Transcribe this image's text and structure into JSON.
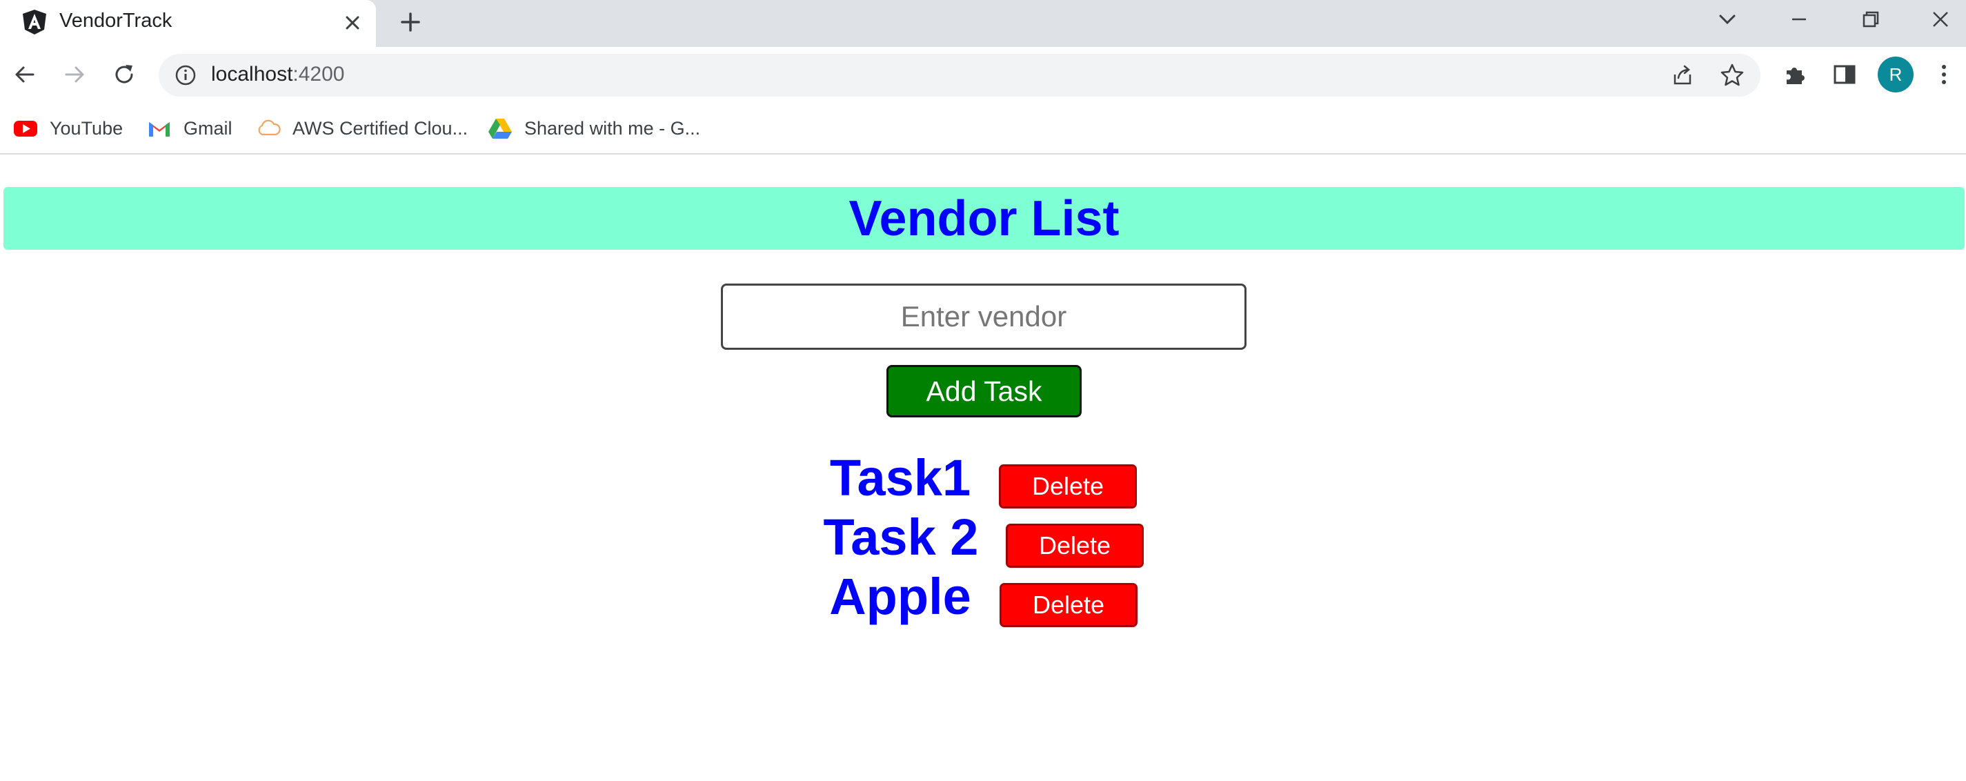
{
  "browser": {
    "tab_title": "VendorTrack",
    "url_host": "localhost",
    "url_port": ":4200",
    "avatar_letter": "R",
    "bookmarks": [
      {
        "label": "YouTube",
        "icon": "youtube-icon"
      },
      {
        "label": "Gmail",
        "icon": "gmail-icon"
      },
      {
        "label": "AWS Certified Clou...",
        "icon": "cloud-icon"
      },
      {
        "label": "Shared with me - G...",
        "icon": "google-drive-icon"
      }
    ]
  },
  "page": {
    "title": "Vendor List",
    "input_placeholder": "Enter vendor",
    "add_button_label": "Add Task",
    "tasks": [
      {
        "name": "Task1",
        "delete_label": "Delete"
      },
      {
        "name": "Task 2",
        "delete_label": "Delete"
      },
      {
        "name": "Apple",
        "delete_label": "Delete"
      }
    ]
  },
  "colors": {
    "header_bg": "#7fffd4",
    "title_text": "#0000ff",
    "add_button": "#008000",
    "delete_button": "#ff0000"
  }
}
